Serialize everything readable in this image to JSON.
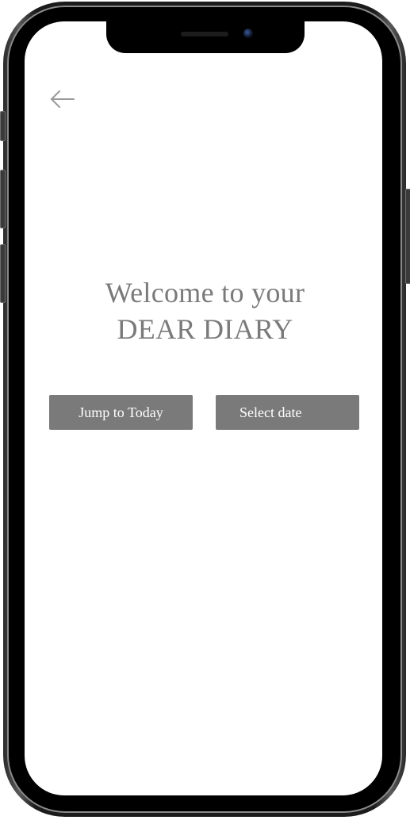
{
  "header": {
    "back_icon": "arrow-left-icon"
  },
  "welcome": {
    "line1": "Welcome to your",
    "line2": "DEAR DIARY"
  },
  "actions": {
    "jump_to_today": "Jump to Today",
    "select_date": "Select date"
  },
  "colors": {
    "button_bg": "#7a7a7a",
    "text_gray": "#7a7a7a",
    "icon_gray": "#9a9a9a"
  }
}
